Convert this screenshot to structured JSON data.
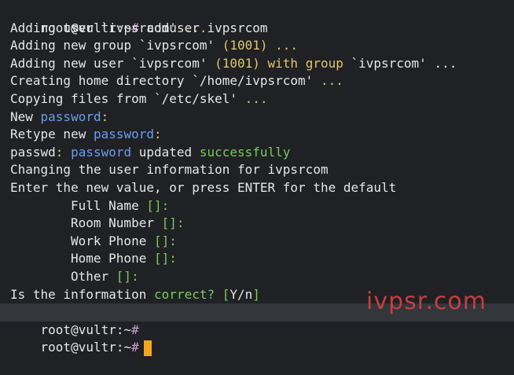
{
  "prompt": {
    "user_host": "root@vultr:~",
    "hash": "#"
  },
  "command": "adduser ivpsrcom",
  "lines": {
    "l1a": "Adding user `ivpsrcom' ",
    "l1b": "...",
    "l2a": "Adding new group `ivpsrcom' ",
    "l2b": "(1001) ...",
    "l3a": "Adding new user `ivpsrcom' ",
    "l3b": "(1001) with group ",
    "l3c": "`ivpsrcom' ...",
    "l4a": "Creating home directory `/home/ivpsrcom' ",
    "l4b": "...",
    "l5a": "Copying files from `/etc/skel' ",
    "l5b": "...",
    "l6a": "New ",
    "l6b": "password",
    "l6c": ":",
    "l7a": "Retype new ",
    "l7b": "password",
    "l7c": ":",
    "l8a": "passwd",
    "l8b": ": ",
    "l8c": "password",
    "l8d": " updated ",
    "l8e": "successfully",
    "l9": "Changing the user information for ivpsrcom",
    "l10": "Enter the new value, or press ENTER for the default",
    "f1": "Full Name ",
    "f2": "Room Number ",
    "f3": "Work Phone ",
    "f4": "Home Phone ",
    "f5": "Other ",
    "brackets": "[]:",
    "l16a": "Is the information ",
    "l16b": "correct? [",
    "l16c": "Y/n",
    "l16d": "]"
  },
  "watermark": "ivpsr.com",
  "colors": {
    "background": "#1f2124",
    "cursor": "#f2a81d",
    "highlight": "#33363b"
  }
}
